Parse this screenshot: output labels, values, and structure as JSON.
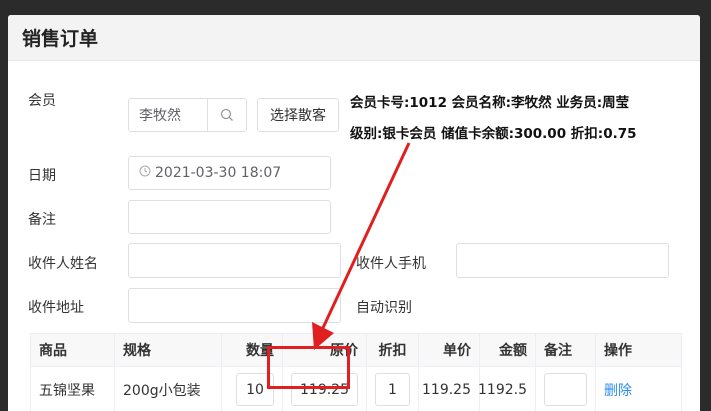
{
  "panel": {
    "title": "销售订单"
  },
  "form": {
    "member_label": "会员",
    "member_value": "李牧然",
    "scatter_button": "选择散客",
    "member_info_line1": "会员卡号:1012 会员名称:李牧然 业务员:周莹",
    "member_info_line2": "级别:银卡会员 储值卡余额:300.00 折扣:0.75",
    "date_label": "日期",
    "date_value": "2021-03-30 18:07",
    "note_label": "备注",
    "receiver_name_label": "收件人姓名",
    "receiver_phone_label": "收件人手机",
    "receiver_address_label": "收件地址",
    "auto_detect": "自动识别"
  },
  "table": {
    "headers": [
      "商品",
      "规格",
      "数量",
      "原价",
      "折扣",
      "单价",
      "金额",
      "备注",
      "操作"
    ],
    "rows": [
      {
        "name": "五锦坚果",
        "spec": "200g小包装",
        "qty": "10",
        "price": "119.25",
        "discount": "1",
        "unit": "119.25",
        "amount": "1192.5",
        "note": "",
        "action": "删除"
      }
    ]
  },
  "colors": {
    "highlight": "#e02020",
    "link": "#2d8cf0"
  }
}
